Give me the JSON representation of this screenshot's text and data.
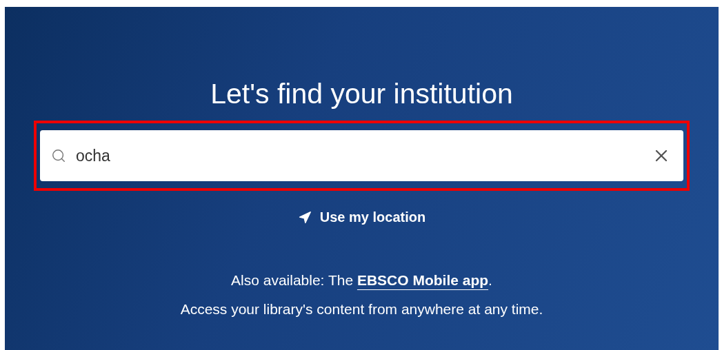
{
  "heading": "Let's find your institution",
  "search": {
    "value": "ocha",
    "highlighted": true
  },
  "location_button": {
    "label": "Use my location"
  },
  "availability": {
    "before": "Also available: The ",
    "link": "EBSCO Mobile app",
    "after": "."
  },
  "note": "Access your library's content from anywhere at any time."
}
